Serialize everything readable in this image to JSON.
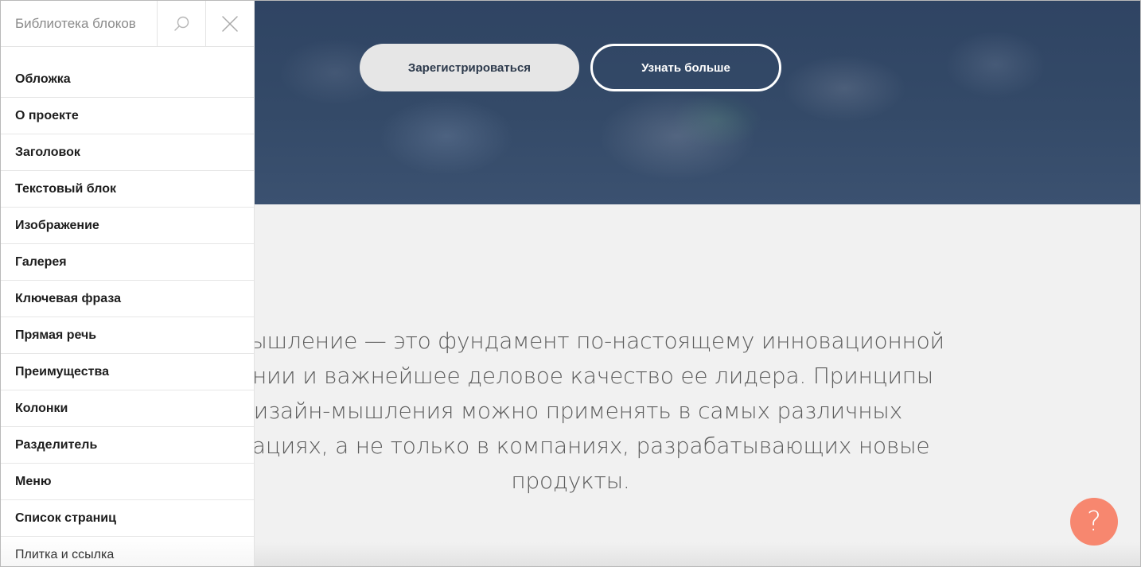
{
  "hero": {
    "register_label": "Зарегистрироваться",
    "learn_more_label": "Узнать больше"
  },
  "quote": {
    "lines": [
      "йн-мышление — это фундамент по-настоящему инновационной",
      "мпании и важнейшее деловое качество ее лидера. Принципы",
      "дизайн-мышления можно применять в самых различных",
      "низациях, а не только в компаниях, разрабатывающих новые",
      "продукты."
    ]
  },
  "help": {
    "label": "?"
  },
  "sidebar": {
    "title": "Библиотека блоков",
    "search_icon": "search-icon",
    "close_icon": "close-icon",
    "items": [
      {
        "label": "Обложка"
      },
      {
        "label": "О проекте"
      },
      {
        "label": "Заголовок"
      },
      {
        "label": "Текстовый блок"
      },
      {
        "label": "Изображение"
      },
      {
        "label": "Галерея"
      },
      {
        "label": "Ключевая фраза"
      },
      {
        "label": "Прямая речь"
      },
      {
        "label": "Преимущества"
      },
      {
        "label": "Колонки"
      },
      {
        "label": "Разделитель"
      },
      {
        "label": "Меню"
      },
      {
        "label": "Список страниц"
      },
      {
        "label": "Плитка и ссылка"
      }
    ]
  },
  "colors": {
    "hero_overlay": "#344a68",
    "help_button": "#f7876f",
    "page_background": "#f1f1f1"
  }
}
